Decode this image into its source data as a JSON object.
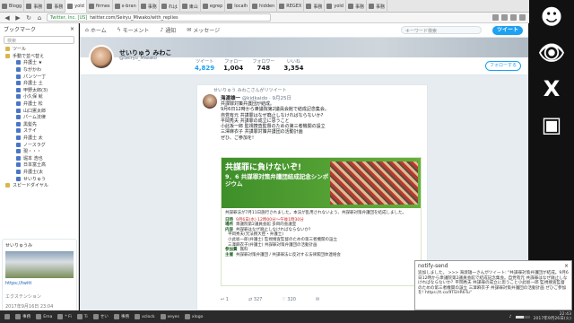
{
  "browser": {
    "tabs": [
      {
        "label": "Blogg"
      },
      {
        "label": "事務"
      },
      {
        "label": "事務"
      },
      {
        "label": "yold"
      },
      {
        "label": "firmes"
      },
      {
        "label": "x-bran"
      },
      {
        "label": "事務"
      },
      {
        "label": "れは"
      },
      {
        "label": "東山"
      },
      {
        "label": "egrep"
      },
      {
        "label": "localh"
      },
      {
        "label": "hidden"
      },
      {
        "label": "REGEX"
      },
      {
        "label": "事務"
      },
      {
        "label": "yold"
      },
      {
        "label": "事務"
      },
      {
        "label": "事務"
      }
    ],
    "url_site": "Twitter, Inc. [US]",
    "url_path": "twitter.com/Seiryu_Miwako/with_replies"
  },
  "sidebar": {
    "title": "ブックマーク",
    "close_icon": "×",
    "search_placeholder": "検索",
    "items": [
      {
        "label": "ツール",
        "type": "folder"
      },
      {
        "label": "手動で並べ替え",
        "type": "folder"
      },
      {
        "label": "弁護士 ★",
        "type": "link"
      },
      {
        "label": "ながかわ",
        "type": "link"
      },
      {
        "label": "パンツ一丁",
        "type": "link"
      },
      {
        "label": "弁護士 土",
        "type": "link"
      },
      {
        "label": "甲野太郎(3)",
        "type": "link"
      },
      {
        "label": "小久保 就",
        "type": "link"
      },
      {
        "label": "弁護士 松",
        "type": "link"
      },
      {
        "label": "山口憲太郎",
        "type": "link"
      },
      {
        "label": "パーム法律",
        "type": "link"
      },
      {
        "label": "黒髪先",
        "type": "link"
      },
      {
        "label": "ステイ",
        "type": "link"
      },
      {
        "label": "弁護士 太",
        "type": "link"
      },
      {
        "label": "ノースラグ",
        "type": "link"
      },
      {
        "label": "現・・・",
        "type": "link"
      },
      {
        "label": "堀本 浩也",
        "type": "link"
      },
      {
        "label": "日本富士高",
        "type": "link"
      },
      {
        "label": "弁護士(太",
        "type": "link"
      },
      {
        "label": "せいりゅう",
        "type": "link"
      },
      {
        "label": "スピードダイヤル",
        "type": "folder"
      }
    ],
    "preview_name": "せいりゅうみ",
    "preview_url": "https://twitt",
    "preview_tab": "エクステンション",
    "preview_time": "2017年9月16日 23:04"
  },
  "twitter": {
    "nav": [
      {
        "label": "ホーム",
        "icon": "home-icon"
      },
      {
        "label": "モーメント",
        "icon": "lightning-icon"
      },
      {
        "label": "通知",
        "icon": "bell-icon"
      },
      {
        "label": "メッセージ",
        "icon": "mail-icon"
      }
    ],
    "search_placeholder": "キーワード検索",
    "tweet_button": "ツイート",
    "profile_name": "せいりゅう みわこ",
    "profile_handle": "@Seiryu_Miwako",
    "stats": [
      {
        "label": "ツイート",
        "value": "4,829"
      },
      {
        "label": "フォロー",
        "value": "1,004"
      },
      {
        "label": "フォロワー",
        "value": "748"
      },
      {
        "label": "いいね",
        "value": "3,354"
      }
    ],
    "follow_button": "フォローする",
    "tweet": {
      "retweet_note": "せいりゅう みわこさんがリツイート",
      "author_name": "海渡雄一",
      "author_handle": "@kidkaido · 9月25日",
      "text": "共謀罪対策弁護団が結成。\n9月6日12時から衆議院第2議員会館で結成記念集会。\n自党有元 共謀罪はなぜ廃止しなければならないか?\n平岡秀夫 共謀罪の成立に思うこと\n小此坂一郎 監視捜査監督のための第三者機関の設立\n三澤麻衣子 共謀罪対策弁護団の活動計画\nぜひ、ご参加を!",
      "poster": {
        "title": "共謀罪に負けないぞ!",
        "subtitle": "9．6 共謀罪対策弁護団結成記念シンポジウム",
        "intro": "共謀罪法が7月11日施行されました。本法が乱用されないよう、共謀罪対策弁護団を結成しました。",
        "rows": [
          {
            "k": "日時",
            "v": "9月6日(水) 12時00分〜午後1時30分"
          },
          {
            "k": "場所",
            "v": "衆議院第2議員会館 多目的会議室"
          },
          {
            "k": "内容",
            "v": "共謀罪はなぜ廃止しなければならないか?"
          },
          {
            "k": "",
            "v": "平岡秀夫(元法務大臣・弁護士)"
          },
          {
            "k": "",
            "v": "小此坂一郎(弁護士) 監視捜査監督のための第三者機関の設立"
          },
          {
            "k": "",
            "v": "三澤麻衣子(弁護士) 共謀罪対策弁護団の活動計画"
          },
          {
            "k": "参加費",
            "v": "無料"
          },
          {
            "k": "主催",
            "v": "共謀罪対策弁護団 / 共謀罪法に反対する法律家団体連絡会"
          }
        ]
      },
      "actions": [
        {
          "icon": "reply-icon",
          "count": "1"
        },
        {
          "icon": "retweet-icon",
          "count": "327"
        },
        {
          "icon": "like-icon",
          "count": "320"
        },
        {
          "icon": "mail-icon",
          "count": ""
        }
      ]
    }
  },
  "notification": {
    "title": "notify-send",
    "body": "追加しました。 >>> 海渡雄一さんがツイート: \"共謀罪対策弁護団が結成。9月6日12時から衆議院第2議員会館で結成記念集会。自党有元 共謀罪はなぜ廃止しなければならないか？平岡秀夫 共謀罪の成立に思うこと小此坂一郎 監視捜査監督のための第三者機関の設立 三澤麻衣子 共謀罪対策弁護団の活動計画 ぜひご参加を! https://t.co/9TEHR6Tu\""
  },
  "taskbar": {
    "items": [
      {
        "label": "事務"
      },
      {
        "label": "Ema"
      },
      {
        "label": "* Fi"
      },
      {
        "label": "Ti"
      },
      {
        "label": "せい"
      },
      {
        "label": "事務"
      },
      {
        "label": "xclock"
      },
      {
        "label": "xeyes"
      },
      {
        "label": "xlogo"
      }
    ],
    "volume": 0.6,
    "time": "22:43",
    "date": "2017年9月26日(火)"
  },
  "desktop": {
    "glyphs": [
      "☻",
      "👁",
      "X",
      "▣"
    ]
  }
}
